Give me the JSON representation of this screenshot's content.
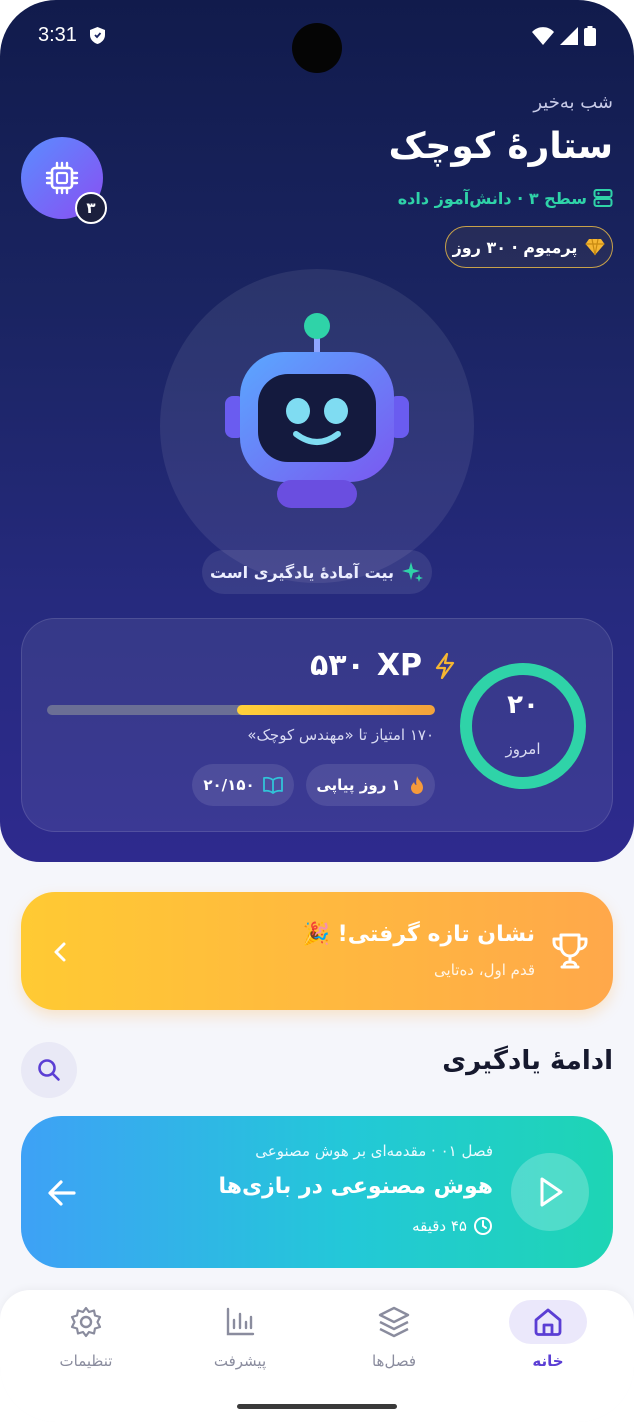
{
  "status_bar": {
    "time": "3:31"
  },
  "header": {
    "greeting": "شب به‌خیر",
    "user_name": "ستارهٔ کوچک",
    "level": "سطح ۳ · دانش‌آموز داده",
    "premium": "پرمیوم · ۳۰ روز",
    "avatar_badge": "۳",
    "avatar_icon": "cpu-chip-icon"
  },
  "robot": {
    "status": "بیت آمادهٔ یادگیری است"
  },
  "stats": {
    "xp_number": "۵۳۰",
    "xp_unit": "XP",
    "xp_progress_fraction": 0.51,
    "to_next_level": "۱۷۰ امتیاز تا «مهندس کوچک»",
    "streak": "۱ روز پیاپی",
    "lessons": "۲۰/۱۵۰",
    "today_value": "۲۰",
    "today_label": "امروز",
    "today_ring_fraction": 1.0
  },
  "badge_banner": {
    "title": "نشان تازه گرفتی! 🎉",
    "subtitle": "قدم اول، ده‌تایی"
  },
  "continue_section": {
    "title": "ادامهٔ یادگیری",
    "lesson": {
      "chapter": "فصل ۰۱ · مقدمه‌ای بر هوش مصنوعی",
      "title": "هوش مصنوعی در بازی‌ها",
      "duration": "۴۵ دقیقه"
    }
  },
  "nav": {
    "home": "خانه",
    "chapters": "فصل‌ها",
    "progress": "پیشرفت",
    "settings": "تنظیمات"
  },
  "colors": {
    "accent": "#5b3ed4",
    "teal": "#2fd3a8",
    "gold": "#f5b632",
    "hero_bg": "#1a2461"
  }
}
